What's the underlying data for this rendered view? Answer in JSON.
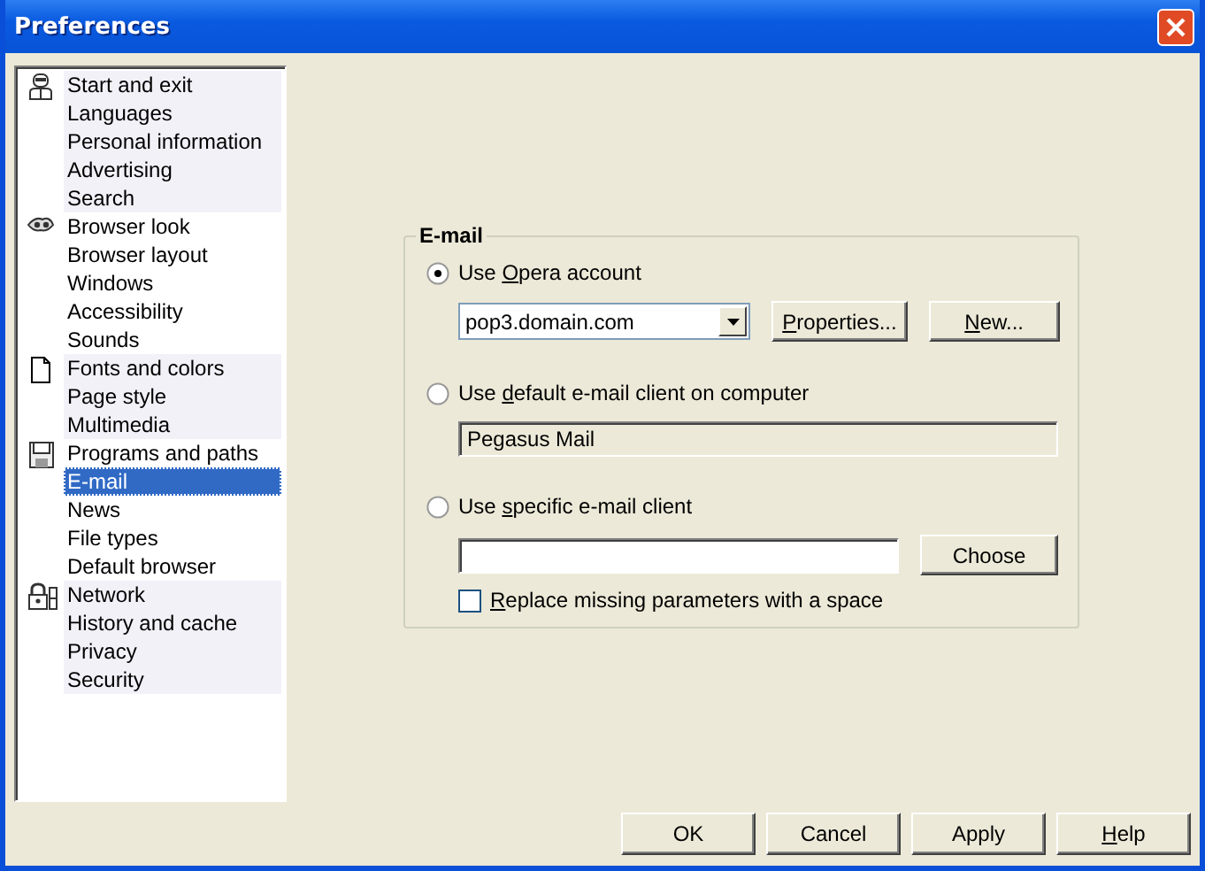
{
  "window": {
    "title": "Preferences"
  },
  "sidebar": {
    "groups": [
      {
        "items": [
          {
            "label": "Start and exit",
            "selected": false
          },
          {
            "label": "Languages",
            "selected": false
          },
          {
            "label": "Personal information",
            "selected": false
          },
          {
            "label": "Advertising",
            "selected": false
          },
          {
            "label": "Search",
            "selected": false
          }
        ]
      },
      {
        "items": [
          {
            "label": "Browser look",
            "selected": false
          },
          {
            "label": "Browser layout",
            "selected": false
          },
          {
            "label": "Windows",
            "selected": false
          },
          {
            "label": "Accessibility",
            "selected": false
          },
          {
            "label": "Sounds",
            "selected": false
          }
        ]
      },
      {
        "items": [
          {
            "label": "Fonts and colors",
            "selected": false
          },
          {
            "label": "Page style",
            "selected": false
          },
          {
            "label": "Multimedia",
            "selected": false
          }
        ]
      },
      {
        "items": [
          {
            "label": "Programs and paths",
            "selected": false
          },
          {
            "label": "E-mail",
            "selected": true
          },
          {
            "label": "News",
            "selected": false
          },
          {
            "label": "File types",
            "selected": false
          },
          {
            "label": "Default browser",
            "selected": false
          }
        ]
      },
      {
        "items": [
          {
            "label": "Network",
            "selected": false
          },
          {
            "label": "History and cache",
            "selected": false
          },
          {
            "label": "Privacy",
            "selected": false
          },
          {
            "label": "Security",
            "selected": false
          }
        ]
      }
    ]
  },
  "email": {
    "legend": "E-mail",
    "options": [
      {
        "kind": "account",
        "selected": true,
        "label": {
          "pre": "Use ",
          "key": "O",
          "post": "pera account"
        },
        "dropdown": {
          "value": "pop3.domain.com"
        },
        "buttons": [
          {
            "key": "P",
            "post": "roperties..."
          },
          {
            "key": "N",
            "post": "ew..."
          }
        ]
      },
      {
        "kind": "default",
        "selected": false,
        "label": {
          "pre": "Use ",
          "key": "d",
          "post": "efault e-mail client on computer"
        },
        "field": {
          "value": "Pegasus Mail",
          "disabled": true
        }
      },
      {
        "kind": "specific",
        "selected": false,
        "label": {
          "pre": "Use ",
          "key": "s",
          "post": "pecific e-mail client"
        },
        "field": {
          "disabled": false
        },
        "button": {
          "pre": "Choose"
        },
        "checkbox": {
          "checked": false,
          "label": {
            "key": "R",
            "post": "eplace missing parameters with a space"
          }
        }
      }
    ]
  },
  "buttons": [
    {
      "pre": "OK"
    },
    {
      "pre": "Cancel"
    },
    {
      "pre": "Apply"
    },
    {
      "key": "H",
      "post": "elp"
    }
  ]
}
